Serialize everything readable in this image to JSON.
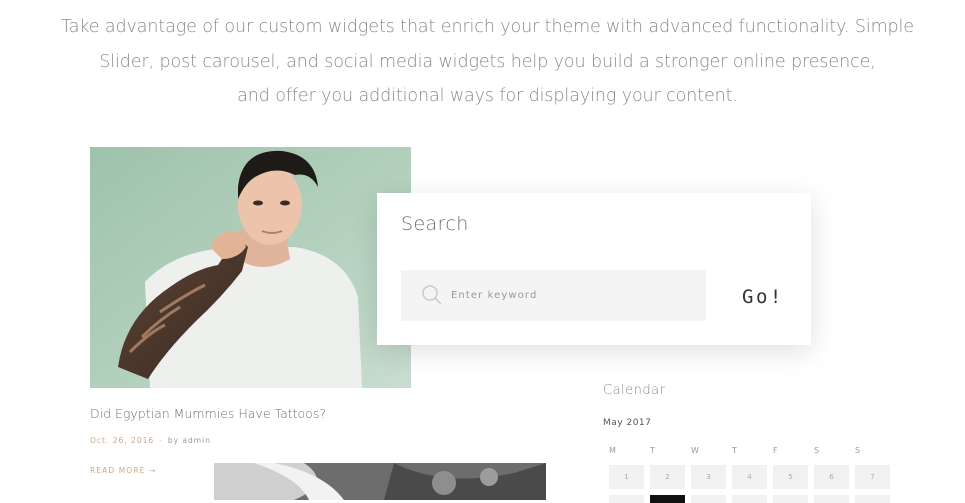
{
  "intro": {
    "lines": [
      "Take advantage of our custom widgets that enrich your theme with advanced functionality. Simple",
      "Slider, post carousel, and social media widgets help you build a stronger online presence,",
      "and offer you additional ways for displaying your content."
    ]
  },
  "post": {
    "title": "Did Egyptian Mummies Have Tattoos?",
    "date": "Oct. 26, 2016",
    "author": "by admin",
    "read_more": "READ MORE →"
  },
  "search": {
    "title": "Search",
    "placeholder": "Enter keyword",
    "button_label": "Go!",
    "icon": "search-icon"
  },
  "calendar": {
    "title": "Calendar",
    "month": "May 2017",
    "weekdays": [
      "M",
      "T",
      "W",
      "T",
      "F",
      "S",
      "S"
    ],
    "days": [
      "1",
      "2",
      "3",
      "4",
      "5",
      "6",
      "7"
    ],
    "highlight_color": "#111111"
  },
  "colors": {
    "accent": "#c7a98a",
    "text": "#777777"
  }
}
